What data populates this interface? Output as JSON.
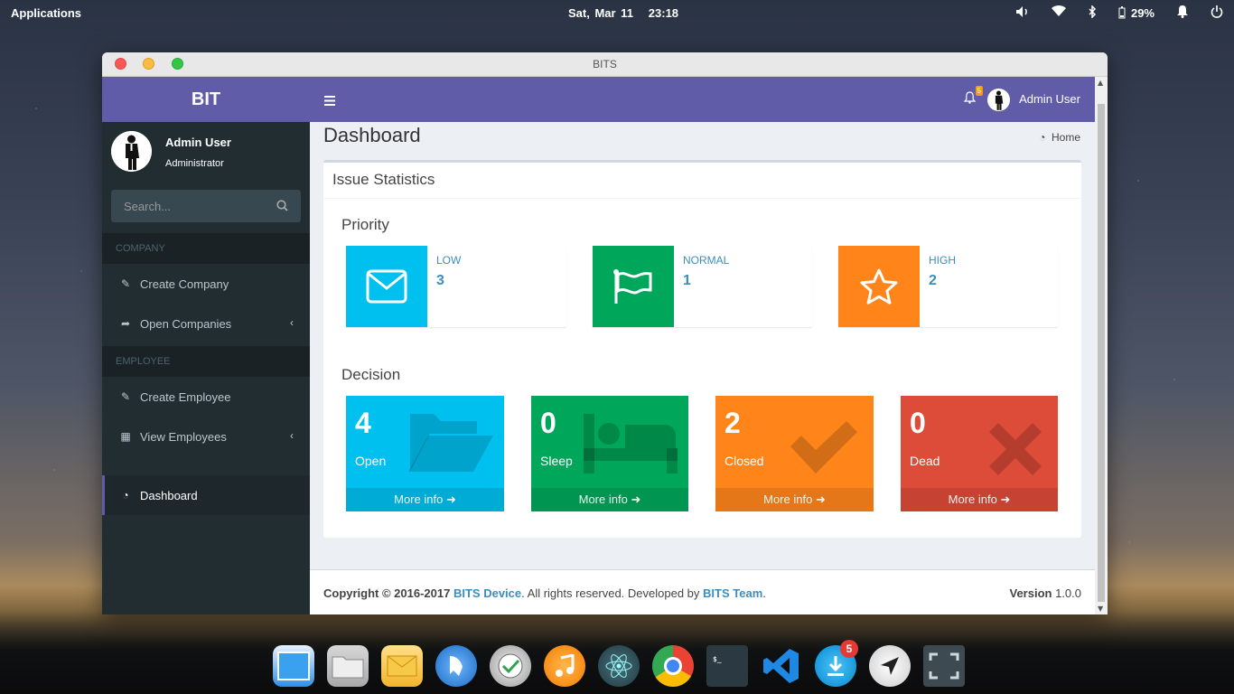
{
  "desktop": {
    "panel": {
      "apps_label": "Applications",
      "date": "Sat, Mar 11",
      "time": "23:18",
      "battery": "29%"
    },
    "dock": {
      "download_badge": "5"
    }
  },
  "window": {
    "title": "BITS"
  },
  "sidebar": {
    "logo": "BIT",
    "user_name": "Admin User",
    "user_role": "Administrator",
    "search_placeholder": "Search...",
    "sections": [
      "COMPANY",
      "EMPLOYEE"
    ],
    "items": [
      {
        "label": "Create Company"
      },
      {
        "label": "Open Companies"
      },
      {
        "label": "Create Employee"
      },
      {
        "label": "View Employees"
      },
      {
        "label": "Dashboard"
      }
    ]
  },
  "topbar": {
    "notification_count": "5",
    "user_name": "Admin User"
  },
  "page": {
    "title": "Dashboard",
    "breadcrumb": "Home"
  },
  "stats": {
    "title": "Issue Statistics",
    "priority_heading": "Priority",
    "priority": [
      {
        "label": "LOW",
        "value": "3",
        "color": "#00c0ef"
      },
      {
        "label": "NORMAL",
        "value": "1",
        "color": "#00a65a"
      },
      {
        "label": "HIGH",
        "value": "2",
        "color": "#ff851b"
      }
    ],
    "decision_heading": "Decision",
    "decision": [
      {
        "value": "4",
        "label": "Open",
        "more": "More info",
        "color": "#00c0ef"
      },
      {
        "value": "0",
        "label": "Sleep",
        "more": "More info",
        "color": "#00a65a"
      },
      {
        "value": "2",
        "label": "Closed",
        "more": "More info",
        "color": "#ff851b"
      },
      {
        "value": "0",
        "label": "Dead",
        "more": "More info",
        "color": "#dd4b39"
      }
    ]
  },
  "footer": {
    "copyright": "Copyright © 2016-2017",
    "company_link": "BITS Device",
    "middle_text": ". All rights reserved. Developed by",
    "team_link": "BITS Team",
    "end": ".",
    "version_label": "Version",
    "version": "1.0.0"
  }
}
